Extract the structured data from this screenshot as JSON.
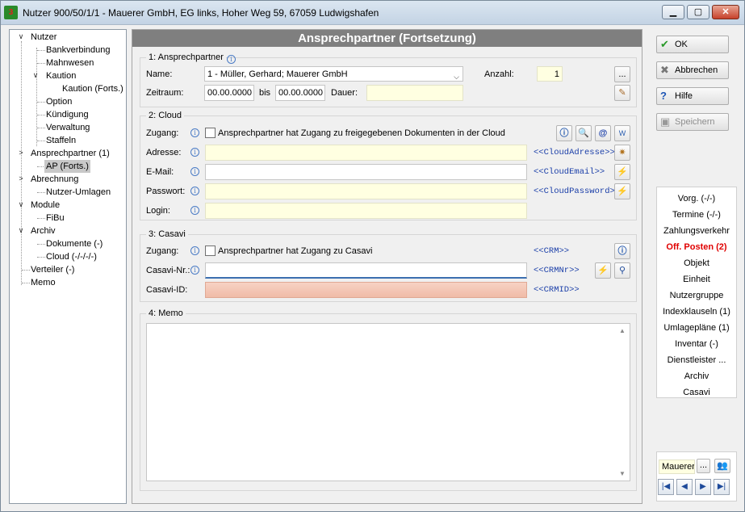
{
  "window": {
    "title": "Nutzer 900/50/1/1 - Mauerer GmbH, EG links, Hoher Weg 59, 67059 Ludwigshafen",
    "minimize": "▁",
    "maximize": "▢",
    "close": "✕"
  },
  "tree": [
    {
      "label": "Nutzer",
      "twist": "∨"
    },
    {
      "label": "Bankverbindung"
    },
    {
      "label": "Mahnwesen"
    },
    {
      "label": "Kaution",
      "twist": "∨"
    },
    {
      "label": "Kaution (Forts.)"
    },
    {
      "label": "Option"
    },
    {
      "label": "Kündigung"
    },
    {
      "label": "Verwaltung"
    },
    {
      "label": "Staffeln"
    },
    {
      "label": "Ansprechpartner (1)",
      "twist": ">"
    },
    {
      "label": "AP (Forts.)"
    },
    {
      "label": "Abrechnung",
      "twist": ">"
    },
    {
      "label": "Nutzer-Umlagen"
    },
    {
      "label": "Module",
      "twist": "∨"
    },
    {
      "label": "FiBu"
    },
    {
      "label": "Archiv",
      "twist": "∨"
    },
    {
      "label": "Dokumente (-)"
    },
    {
      "label": "Cloud (-/-/-/-)"
    },
    {
      "label": "Verteiler (-)"
    },
    {
      "label": "Memo"
    }
  ],
  "main": {
    "header": "Ansprechpartner (Fortsetzung)",
    "g1": {
      "title": "1: Ansprechpartner",
      "name_label": "Name:",
      "name_value": "1 - Müller, Gerhard; Mauerer GmbH",
      "anzahl_label": "Anzahl:",
      "anzahl_value": "1",
      "more_button": "...",
      "zeitraum_label": "Zeitraum:",
      "from_value": "00.00.0000",
      "bis_label": "bis",
      "to_value": "00.00.0000",
      "dauer_label": "Dauer:",
      "dauer_value": ""
    },
    "g2": {
      "title": "2: Cloud",
      "zugang_label": "Zugang:",
      "zugang_checkbox_label": "Ansprechpartner hat Zugang zu freigegebenen Dokumenten in der Cloud",
      "adresse_label": "Adresse:",
      "adresse_value": "",
      "adresse_tag": "<<CloudAdresse>>",
      "email_label": "E-Mail:",
      "email_value": "",
      "email_tag": "<<CloudEmail>>",
      "passwort_label": "Passwort:",
      "passwort_value": "",
      "passwort_tag": "<<CloudPassword>>",
      "login_label": "Login:",
      "login_value": ""
    },
    "g3": {
      "title": "3: Casavi",
      "zugang_label": "Zugang:",
      "zugang_checkbox_label": "Ansprechpartner hat Zugang zu Casavi",
      "crm_tag": "<<CRM>>",
      "casavinr_label": "Casavi-Nr.:",
      "casavinr_value": "",
      "crmnr_tag": "<<CRMNr>>",
      "casaviid_label": "Casavi-ID:",
      "casaviid_value": "",
      "crmid_tag": "<<CRMID>>"
    },
    "g4": {
      "title": "4: Memo",
      "memo_value": ""
    }
  },
  "actions": {
    "ok": "OK",
    "cancel": "Abbrechen",
    "help": "Hilfe",
    "save": "Speichern"
  },
  "right_list": [
    {
      "label": "Vorg. (-/-)"
    },
    {
      "label": "Termine (-/-)"
    },
    {
      "label": "Zahlungsverkehr"
    },
    {
      "label": "Off. Posten (2)",
      "highlight": true
    },
    {
      "label": "Objekt"
    },
    {
      "label": "Einheit"
    },
    {
      "label": "Nutzergruppe"
    },
    {
      "label": "Indexklauseln (1)"
    },
    {
      "label": "Umlagepläne (1)"
    },
    {
      "label": "Inventar (-)"
    },
    {
      "label": "Dienstleister ..."
    },
    {
      "label": "Archiv"
    },
    {
      "label": "Casavi"
    }
  ],
  "bottom": {
    "name_value": "Mauerer",
    "more_button": "...",
    "nav_first": "|◀",
    "nav_prev": "◀",
    "nav_next": "▶",
    "nav_last": "▶|"
  },
  "colors": {
    "header_bg": "#7f7f7f",
    "required_field": "#ffffe1",
    "error_field": "#f2c3b1",
    "tag_text": "#1a3ea8",
    "highlight_text": "#e00000"
  }
}
